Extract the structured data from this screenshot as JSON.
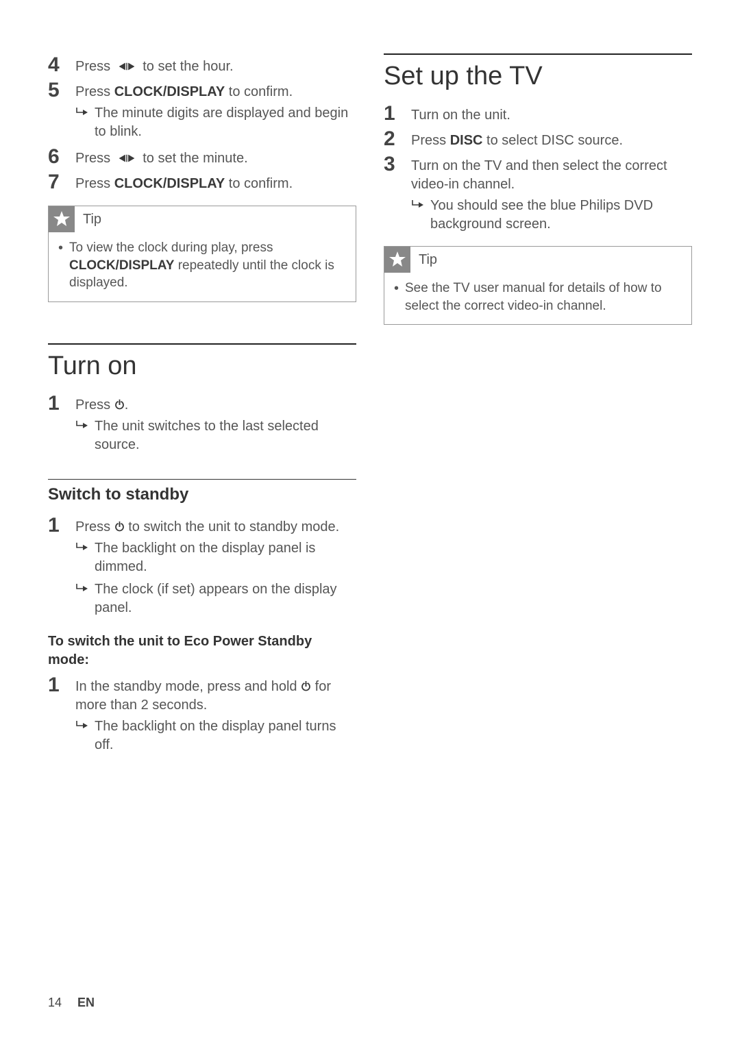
{
  "left": {
    "steps_top": [
      {
        "num": "4",
        "pre": "Press ",
        "bold": "",
        "post": " to set the hour.",
        "icon": "seek"
      },
      {
        "num": "5",
        "pre": "Press ",
        "bold": "CLOCK/DISPLAY",
        "post": " to confirm.",
        "sub": [
          "The minute digits are displayed and begin to blink."
        ]
      },
      {
        "num": "6",
        "pre": "Press ",
        "bold": "",
        "post": " to set the minute.",
        "icon": "seek"
      },
      {
        "num": "7",
        "pre": "Press ",
        "bold": "CLOCK/DISPLAY",
        "post": " to confirm."
      }
    ],
    "tip1": {
      "label": "Tip",
      "text_pre": "To view the clock during play, press ",
      "text_bold": "CLOCK/DISPLAY",
      "text_post": " repeatedly until the clock is displayed."
    },
    "section_turnon": {
      "title": "Turn on",
      "step": {
        "num": "1",
        "pre": "Press ",
        "post": ".",
        "icon": "power"
      },
      "sub": [
        "The unit switches to the last selected source."
      ]
    },
    "section_standby": {
      "title": "Switch to standby",
      "step": {
        "num": "1",
        "pre": "Press ",
        "post": " to switch the unit to standby mode.",
        "icon": "power"
      },
      "subs": [
        "The backlight on the display panel is dimmed.",
        "The clock (if set) appears on the display panel."
      ],
      "eco_heading": "To switch the unit to Eco Power Standby mode:",
      "eco_step": {
        "num": "1",
        "pre": "In the standby mode, press and hold ",
        "post": " for more than 2 seconds.",
        "icon": "power"
      },
      "eco_sub": [
        "The backlight on the display panel turns off."
      ]
    }
  },
  "right": {
    "section_tv": {
      "title": "Set up the TV",
      "steps": [
        {
          "num": "1",
          "text": "Turn on the unit."
        },
        {
          "num": "2",
          "pre": "Press ",
          "bold": "DISC",
          "post": " to select DISC source."
        },
        {
          "num": "3",
          "text": "Turn on the TV and then select the correct video-in channel.",
          "sub": [
            "You should see the blue Philips DVD background screen."
          ]
        }
      ]
    },
    "tip2": {
      "label": "Tip",
      "text": "See the TV user manual for details of how to select the correct video-in channel."
    }
  },
  "footer": {
    "page": "14",
    "lang": "EN"
  }
}
